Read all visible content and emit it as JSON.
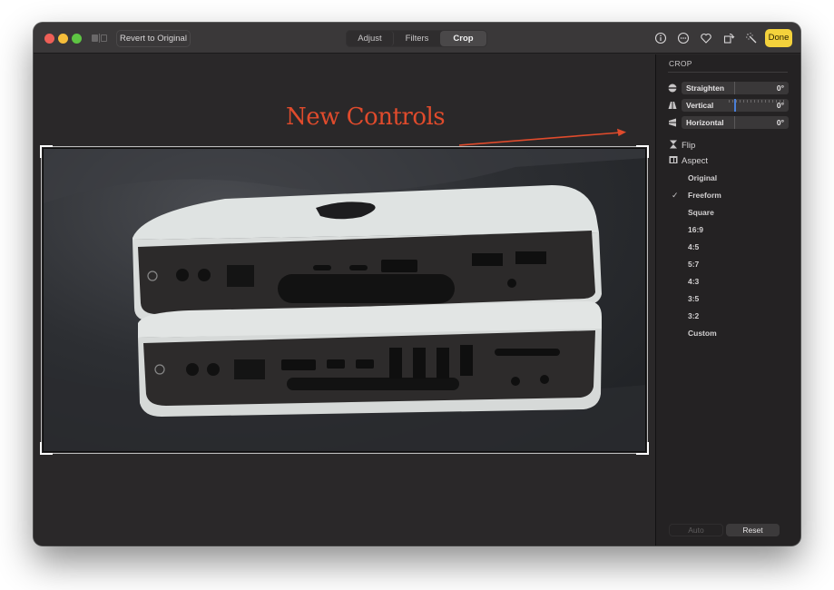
{
  "toolbar": {
    "revert_label": "Revert to Original",
    "tabs": [
      {
        "label": "Adjust",
        "active": false
      },
      {
        "label": "Filters",
        "active": false
      },
      {
        "label": "Crop",
        "active": true
      }
    ],
    "icons": [
      "info-icon",
      "more-icon",
      "heart-icon",
      "rotate-icon",
      "magic-wand-icon"
    ],
    "done_label": "Done",
    "done_color": "#f4d23c"
  },
  "canvas": {
    "annotation": "New Controls",
    "annotation_color": "#e04b2c",
    "photo_description": "Two stacked Mac mini computers, rear ports visible, on dark fabric"
  },
  "sidebar": {
    "title": "CROP",
    "sliders": [
      {
        "label": "Straighten",
        "value": "0°",
        "icon": "straighten-icon",
        "active": false
      },
      {
        "label": "Vertical",
        "value": "0°",
        "icon": "vertical-perspective-icon",
        "active": true
      },
      {
        "label": "Horizontal",
        "value": "0°",
        "icon": "horizontal-perspective-icon",
        "active": false
      }
    ],
    "flip_label": "Flip",
    "aspect_label": "Aspect",
    "aspect_options": [
      {
        "label": "Original",
        "selected": false
      },
      {
        "label": "Freeform",
        "selected": true
      },
      {
        "label": "Square",
        "selected": false
      },
      {
        "label": "16:9",
        "selected": false
      },
      {
        "label": "4:5",
        "selected": false
      },
      {
        "label": "5:7",
        "selected": false
      },
      {
        "label": "4:3",
        "selected": false
      },
      {
        "label": "3:5",
        "selected": false
      },
      {
        "label": "3:2",
        "selected": false
      },
      {
        "label": "Custom",
        "selected": false
      }
    ],
    "check_mark": "✓",
    "auto_label": "Auto",
    "reset_label": "Reset"
  }
}
